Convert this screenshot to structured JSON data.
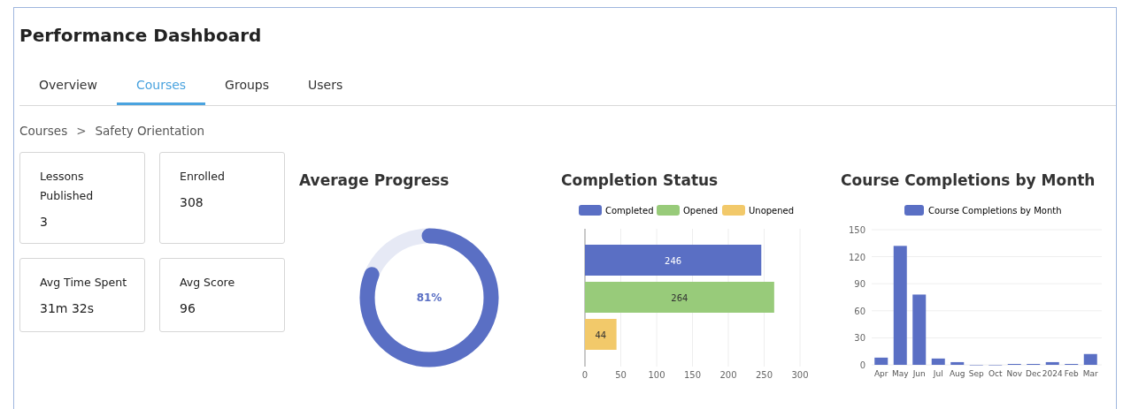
{
  "title": "Performance Dashboard",
  "tabs": [
    {
      "label": "Overview",
      "selected": false
    },
    {
      "label": "Courses",
      "selected": true
    },
    {
      "label": "Groups",
      "selected": false
    },
    {
      "label": "Users",
      "selected": false
    }
  ],
  "breadcrumb": [
    {
      "label": "Courses"
    },
    {
      "label": "Safety Orientation"
    }
  ],
  "breadcrumb_separator": ">",
  "stats": [
    {
      "label": "Lessons Published",
      "value": "3"
    },
    {
      "label": "Enrolled",
      "value": "308"
    },
    {
      "label": "Avg Time Spent",
      "value": "31m 32s"
    },
    {
      "label": "Avg Score",
      "value": "96"
    }
  ],
  "average_progress": {
    "title": "Average Progress",
    "level": 0.81,
    "reading": "81%"
  },
  "completion_status": {
    "title": "Completion Status",
    "chart_data": {
      "type": "bar",
      "orientation": "horizontal",
      "series": [
        {
          "name": "Completed",
          "color": "#5a6fc4",
          "values": [
            246
          ]
        },
        {
          "name": "Opened",
          "color": "#98cb7a",
          "values": [
            264
          ]
        },
        {
          "name": "Unopened",
          "color": "#f2c96a",
          "values": [
            44
          ]
        }
      ],
      "xlim": [
        0,
        300
      ],
      "xticks": [
        0,
        50,
        100,
        150,
        200,
        250,
        300
      ],
      "data_labels": true,
      "grid": true,
      "legend": "top"
    }
  },
  "monthly": {
    "title": "Course Completions by Month",
    "chart_data": {
      "type": "bar",
      "categories": [
        "Apr",
        "May",
        "Jun",
        "Jul",
        "Aug",
        "Sep",
        "Oct",
        "Nov",
        "Dec",
        "2024",
        "Feb",
        "Mar"
      ],
      "series": [
        {
          "name": "Course Completions by Month",
          "color": "#5a6fc4",
          "values": [
            8,
            132,
            78,
            7,
            3,
            0,
            0,
            1,
            1,
            3,
            1,
            12
          ]
        }
      ],
      "ylim": [
        0,
        150
      ],
      "yticks": [
        0,
        30,
        60,
        90,
        120,
        150
      ],
      "grid": true,
      "legend": "top"
    }
  }
}
